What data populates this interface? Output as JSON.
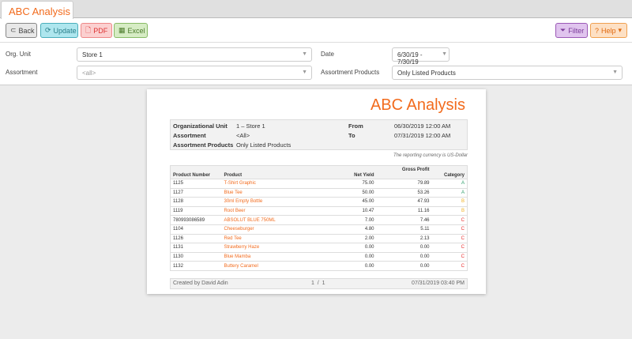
{
  "tab": {
    "title": "ABC Analysis"
  },
  "toolbar": {
    "back": "Back",
    "update": "Update",
    "pdf": "PDF",
    "excel": "Excel",
    "filter": "Filter",
    "help": "Help"
  },
  "filters": {
    "org_unit_label": "Org. Unit",
    "org_unit_value": "Store 1",
    "assortment_label": "Assortment",
    "assortment_placeholder": "<all>",
    "date_label": "Date",
    "date_value": "6/30/19 - 7/30/19",
    "assortment_products_label": "Assortment Products",
    "assortment_products_value": "Only Listed Products"
  },
  "report": {
    "title": "ABC Analysis",
    "info": {
      "org_unit_label": "Organizational Unit",
      "org_unit": "1 – Store 1",
      "assortment_label": "Assortment",
      "assortment": "<All>",
      "assortment_products_label": "Assortment Products",
      "assortment_products": "Only Listed Products",
      "from_label": "From",
      "from": "06/30/2019 12:00 AM",
      "to_label": "To",
      "to": "07/31/2019 12:00 AM"
    },
    "currency_note": "The reporting currency is US-Dollar",
    "columns": [
      "Product Number",
      "Product",
      "Net Yield",
      "Gross Profit",
      "Category"
    ],
    "rows": [
      [
        "1125",
        "T-Shirt Graphic",
        "75.00",
        "79.89",
        "A"
      ],
      [
        "1127",
        "Blue Tee",
        "50.00",
        "53.26",
        "A"
      ],
      [
        "1128",
        "30ml Empty Bottle",
        "45.00",
        "47.93",
        "B"
      ],
      [
        "1119",
        "Root Beer",
        "10.47",
        "11.16",
        "B"
      ],
      [
        "780993086589",
        "ABSOLUT BLUE 750ML",
        "7.00",
        "7.46",
        "C"
      ],
      [
        "1104",
        "Cheeseburger",
        "4.80",
        "5.11",
        "C"
      ],
      [
        "1126",
        "Red Tee",
        "2.00",
        "2.13",
        "C"
      ],
      [
        "1131",
        "Strawberry Haze",
        "0.00",
        "0.00",
        "C"
      ],
      [
        "1130",
        "Blue Mamba",
        "0.00",
        "0.00",
        "C"
      ],
      [
        "1132",
        "Buttery Caramel",
        "0.00",
        "0.00",
        "C"
      ]
    ],
    "category_colors": {
      "A": "#2e9e6a",
      "B": "#f0b020",
      "C": "#e83030"
    },
    "footer": {
      "created_by": "Created by David Adin",
      "pages": "1  /  1",
      "timestamp": "07/31/2019 03:40 PM"
    }
  }
}
